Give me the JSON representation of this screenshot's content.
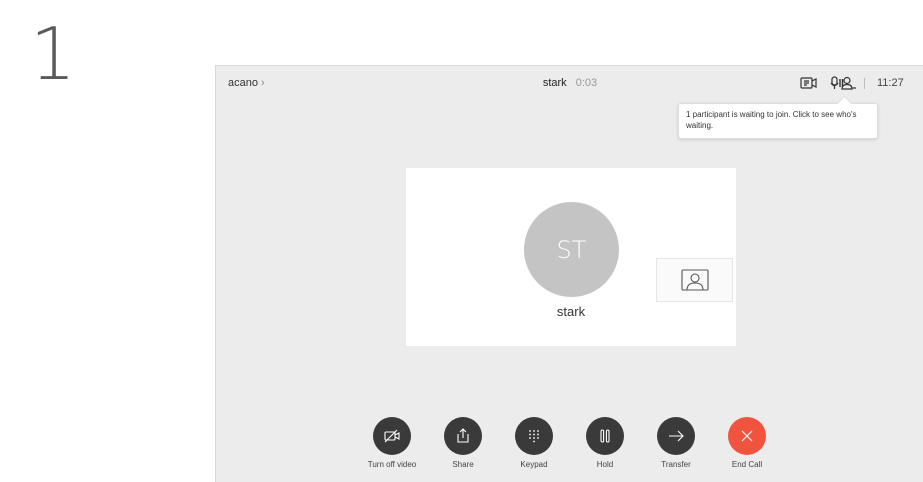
{
  "step": {
    "number": "1"
  },
  "topbar": {
    "brand": "acano",
    "brand_chevron": "›",
    "call_name": "stark",
    "call_timer": "0:03",
    "icons": [
      "share-screen-icon",
      "mic-icon",
      "participants-icon"
    ],
    "clock": "11:27"
  },
  "tooltip": {
    "text": "1 participant is waiting to join. Click to see who's waiting."
  },
  "call": {
    "initials": "ST",
    "name": "stark"
  },
  "controls": [
    {
      "label": "Turn off video",
      "icon": "video-off-icon",
      "color": "#3a3a3a"
    },
    {
      "label": "Share",
      "icon": "share-icon",
      "color": "#3a3a3a"
    },
    {
      "label": "Keypad",
      "icon": "keypad-icon",
      "color": "#3a3a3a"
    },
    {
      "label": "Hold",
      "icon": "hold-icon",
      "color": "#3a3a3a"
    },
    {
      "label": "Transfer",
      "icon": "transfer-icon",
      "color": "#3a3a3a"
    },
    {
      "label": "End Call",
      "icon": "end-call-icon",
      "color": "#f2533f"
    }
  ]
}
